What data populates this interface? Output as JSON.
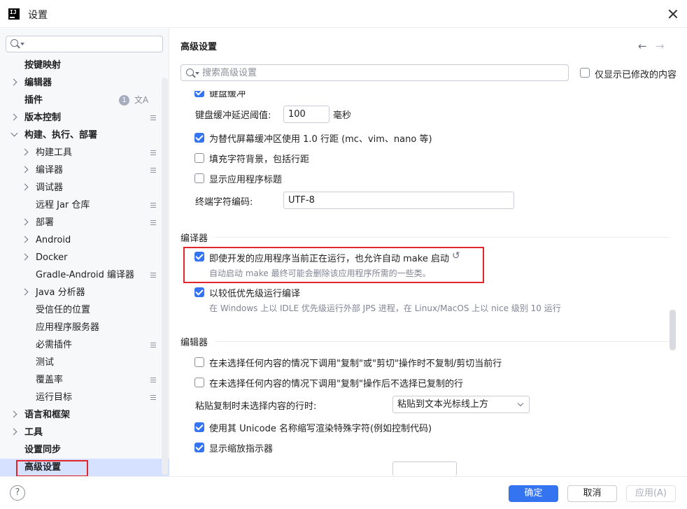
{
  "window": {
    "title": "设置"
  },
  "sidebar": {
    "search_placeholder": "",
    "items": [
      {
        "label": "按键映射"
      },
      {
        "label": "编辑器"
      },
      {
        "label": "插件",
        "badge": "1"
      },
      {
        "label": "版本控制"
      },
      {
        "label": "构建、执行、部署"
      },
      {
        "label": "构建工具"
      },
      {
        "label": "编译器"
      },
      {
        "label": "调试器"
      },
      {
        "label": "远程 Jar 仓库"
      },
      {
        "label": "部署"
      },
      {
        "label": "Android"
      },
      {
        "label": "Docker"
      },
      {
        "label": "Gradle-Android 编译器"
      },
      {
        "label": "Java 分析器"
      },
      {
        "label": "受信任的位置"
      },
      {
        "label": "应用程序服务器"
      },
      {
        "label": "必需插件"
      },
      {
        "label": "测试"
      },
      {
        "label": "覆盖率"
      },
      {
        "label": "运行目标"
      },
      {
        "label": "语言和框架"
      },
      {
        "label": "工具"
      },
      {
        "label": "设置同步"
      },
      {
        "label": "高级设置"
      }
    ]
  },
  "main": {
    "title": "高级设置",
    "nav_back": "←",
    "nav_forward": "→",
    "search_placeholder": "搜索高级设置",
    "only_modified": "仅显示已修改的内容",
    "top_group": {
      "disk_buffer_partial": "键盘缓冲",
      "disk_buffer_delay_label": "键盘缓冲延迟阈值:",
      "disk_buffer_delay_value": "100",
      "disk_buffer_delay_unit": "毫秒",
      "line_spacing": "为替代屏幕缓冲区使用 1.0 行距 (mc、vim、nano 等)",
      "fill_char_bg": "填充字符背景，包括行距",
      "show_app_title": "显示应用程序标题",
      "terminal_encoding_label": "终端字符编码:",
      "terminal_encoding_value": "UTF-8"
    },
    "compiler_section": {
      "title": "编译器",
      "auto_make": "即使开发的应用程序当前正在运行，也允许自动 make 启动",
      "auto_make_hint": "自动启动 make 最终可能会删除该应用程序所需的一些类。",
      "low_priority": "以较低优先级运行编译",
      "low_priority_hint": "在 Windows 上以 IDLE 优先级运行外部 JPS 进程，在 Linux/MacOS 上以 nice 级别 10 运行"
    },
    "editor_section": {
      "title": "编辑器",
      "copy_no_selection": "在未选择任何内容的情况下调用\"复制\"或\"剪切\"操作时不复制/剪切当前行",
      "no_select_after_copy": "在未选择任何内容的情况下调用\"复制\"操作后不选择已复制的行",
      "paste_label": "粘贴复制时未选择内容的行时:",
      "paste_value": "粘贴到文本光标线上方",
      "unicode_names": "使用其 Unicode 名称缩写渲染特殊字符(例如控制代码)",
      "zoom_indicator": "显示缩放指示器"
    }
  },
  "footer": {
    "help": "?",
    "ok": "确定",
    "cancel": "取消",
    "apply": "应用(A)"
  },
  "colors": {
    "accent": "#3574f0",
    "highlight_box": "#e0262c",
    "selected_bg": "#d5e1ff"
  }
}
